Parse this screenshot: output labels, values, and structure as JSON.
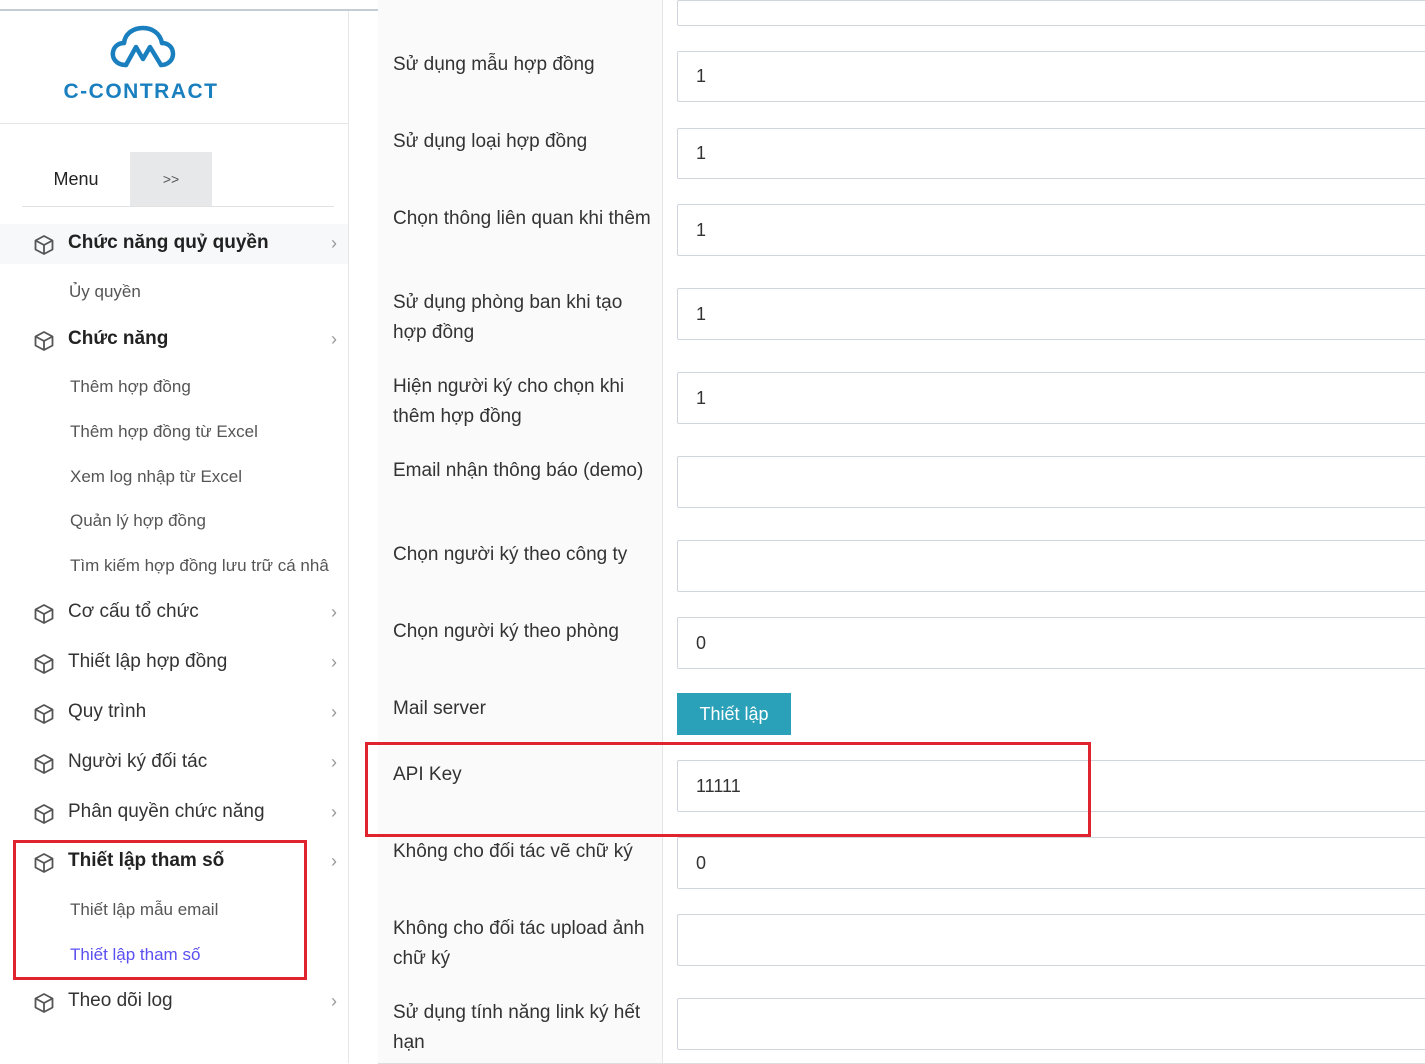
{
  "logo": {
    "text": "C-CONTRACT",
    "color": "#1a7fbf"
  },
  "tabs": {
    "menu": "Menu",
    "expand": ">>"
  },
  "menu": {
    "items": [
      {
        "label": "Chức năng quỷ quyền",
        "icon": "cube-icon",
        "bold": true
      },
      {
        "label": "Ủy quyền",
        "sub": true
      },
      {
        "label": "Chức năng",
        "icon": "cube-icon",
        "bold": true
      },
      {
        "label": "Thêm hợp đồng",
        "sub": true
      },
      {
        "label": "Thêm hợp đồng từ Excel",
        "sub": true
      },
      {
        "label": "Xem log nhập từ Excel",
        "sub": true
      },
      {
        "label": "Quản lý hợp đồng",
        "sub": true
      },
      {
        "label": "Tìm kiếm hợp đồng lưu trữ cá nhâ",
        "sub": true
      },
      {
        "label": "Cơ cấu tổ chức",
        "icon": "cube-icon"
      },
      {
        "label": "Thiết lập hợp đồng",
        "icon": "cube-icon"
      },
      {
        "label": "Quy trình",
        "icon": "cube-icon"
      },
      {
        "label": "Người ký đối tác",
        "icon": "cube-icon"
      },
      {
        "label": "Phân quyền chức năng",
        "icon": "cube-icon"
      },
      {
        "label": "Thiết lập tham số",
        "icon": "cube-icon",
        "bold": true
      },
      {
        "label": "Thiết lập mẫu email",
        "sub": true
      },
      {
        "label": "Thiết lập tham số",
        "sub": true,
        "active": true
      },
      {
        "label": "Theo dõi log",
        "icon": "cube-icon"
      }
    ],
    "chevron": "›"
  },
  "form": {
    "rows": [
      {
        "label": "Sử dụng mẫu hợp đồng",
        "value": "1"
      },
      {
        "label": "Sử dụng loại hợp đồng",
        "value": "1"
      },
      {
        "label": "Chọn thông liên quan khi thêm",
        "value": "1"
      },
      {
        "label": "Sử dụng phòng ban khi tạo hợp đồng",
        "value": "1"
      },
      {
        "label": "Hiện người ký cho chọn khi thêm hợp đồng",
        "value": "1"
      },
      {
        "label": "Email nhận thông báo (demo)",
        "value": ""
      },
      {
        "label": "Chọn người ký theo công ty",
        "value": ""
      },
      {
        "label": "Chọn người ký theo phòng",
        "value": "0"
      },
      {
        "label": "Mail server",
        "button": "Thiết lập"
      },
      {
        "label": "API Key",
        "value": "11111"
      },
      {
        "label": "Không cho đối tác vẽ chữ ký",
        "value": "0"
      },
      {
        "label": "Không cho đối tác upload ảnh chữ ký",
        "value": ""
      },
      {
        "label": "Sử dụng tính năng link ký hết hạn",
        "value": ""
      }
    ]
  },
  "colors": {
    "highlight": "#e0242f",
    "button": "#2aa1b8",
    "active_link": "#5a4ff0"
  }
}
